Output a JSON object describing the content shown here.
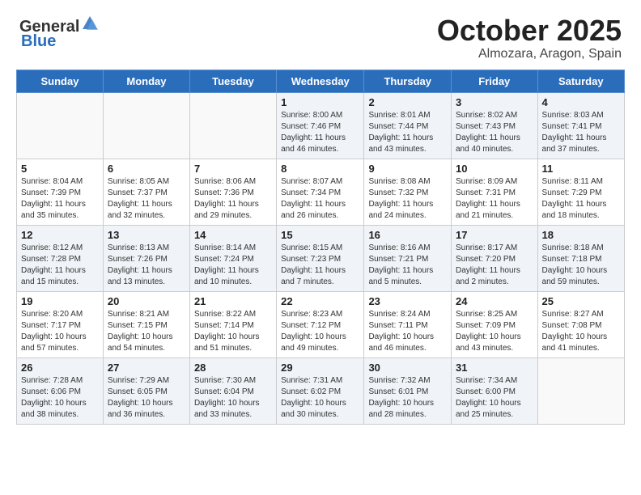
{
  "logo": {
    "general": "General",
    "blue": "Blue"
  },
  "header": {
    "month": "October 2025",
    "location": "Almozara, Aragon, Spain"
  },
  "weekdays": [
    "Sunday",
    "Monday",
    "Tuesday",
    "Wednesday",
    "Thursday",
    "Friday",
    "Saturday"
  ],
  "weeks": [
    [
      {
        "day": "",
        "info": ""
      },
      {
        "day": "",
        "info": ""
      },
      {
        "day": "",
        "info": ""
      },
      {
        "day": "1",
        "info": "Sunrise: 8:00 AM\nSunset: 7:46 PM\nDaylight: 11 hours and 46 minutes."
      },
      {
        "day": "2",
        "info": "Sunrise: 8:01 AM\nSunset: 7:44 PM\nDaylight: 11 hours and 43 minutes."
      },
      {
        "day": "3",
        "info": "Sunrise: 8:02 AM\nSunset: 7:43 PM\nDaylight: 11 hours and 40 minutes."
      },
      {
        "day": "4",
        "info": "Sunrise: 8:03 AM\nSunset: 7:41 PM\nDaylight: 11 hours and 37 minutes."
      }
    ],
    [
      {
        "day": "5",
        "info": "Sunrise: 8:04 AM\nSunset: 7:39 PM\nDaylight: 11 hours and 35 minutes."
      },
      {
        "day": "6",
        "info": "Sunrise: 8:05 AM\nSunset: 7:37 PM\nDaylight: 11 hours and 32 minutes."
      },
      {
        "day": "7",
        "info": "Sunrise: 8:06 AM\nSunset: 7:36 PM\nDaylight: 11 hours and 29 minutes."
      },
      {
        "day": "8",
        "info": "Sunrise: 8:07 AM\nSunset: 7:34 PM\nDaylight: 11 hours and 26 minutes."
      },
      {
        "day": "9",
        "info": "Sunrise: 8:08 AM\nSunset: 7:32 PM\nDaylight: 11 hours and 24 minutes."
      },
      {
        "day": "10",
        "info": "Sunrise: 8:09 AM\nSunset: 7:31 PM\nDaylight: 11 hours and 21 minutes."
      },
      {
        "day": "11",
        "info": "Sunrise: 8:11 AM\nSunset: 7:29 PM\nDaylight: 11 hours and 18 minutes."
      }
    ],
    [
      {
        "day": "12",
        "info": "Sunrise: 8:12 AM\nSunset: 7:28 PM\nDaylight: 11 hours and 15 minutes."
      },
      {
        "day": "13",
        "info": "Sunrise: 8:13 AM\nSunset: 7:26 PM\nDaylight: 11 hours and 13 minutes."
      },
      {
        "day": "14",
        "info": "Sunrise: 8:14 AM\nSunset: 7:24 PM\nDaylight: 11 hours and 10 minutes."
      },
      {
        "day": "15",
        "info": "Sunrise: 8:15 AM\nSunset: 7:23 PM\nDaylight: 11 hours and 7 minutes."
      },
      {
        "day": "16",
        "info": "Sunrise: 8:16 AM\nSunset: 7:21 PM\nDaylight: 11 hours and 5 minutes."
      },
      {
        "day": "17",
        "info": "Sunrise: 8:17 AM\nSunset: 7:20 PM\nDaylight: 11 hours and 2 minutes."
      },
      {
        "day": "18",
        "info": "Sunrise: 8:18 AM\nSunset: 7:18 PM\nDaylight: 10 hours and 59 minutes."
      }
    ],
    [
      {
        "day": "19",
        "info": "Sunrise: 8:20 AM\nSunset: 7:17 PM\nDaylight: 10 hours and 57 minutes."
      },
      {
        "day": "20",
        "info": "Sunrise: 8:21 AM\nSunset: 7:15 PM\nDaylight: 10 hours and 54 minutes."
      },
      {
        "day": "21",
        "info": "Sunrise: 8:22 AM\nSunset: 7:14 PM\nDaylight: 10 hours and 51 minutes."
      },
      {
        "day": "22",
        "info": "Sunrise: 8:23 AM\nSunset: 7:12 PM\nDaylight: 10 hours and 49 minutes."
      },
      {
        "day": "23",
        "info": "Sunrise: 8:24 AM\nSunset: 7:11 PM\nDaylight: 10 hours and 46 minutes."
      },
      {
        "day": "24",
        "info": "Sunrise: 8:25 AM\nSunset: 7:09 PM\nDaylight: 10 hours and 43 minutes."
      },
      {
        "day": "25",
        "info": "Sunrise: 8:27 AM\nSunset: 7:08 PM\nDaylight: 10 hours and 41 minutes."
      }
    ],
    [
      {
        "day": "26",
        "info": "Sunrise: 7:28 AM\nSunset: 6:06 PM\nDaylight: 10 hours and 38 minutes."
      },
      {
        "day": "27",
        "info": "Sunrise: 7:29 AM\nSunset: 6:05 PM\nDaylight: 10 hours and 36 minutes."
      },
      {
        "day": "28",
        "info": "Sunrise: 7:30 AM\nSunset: 6:04 PM\nDaylight: 10 hours and 33 minutes."
      },
      {
        "day": "29",
        "info": "Sunrise: 7:31 AM\nSunset: 6:02 PM\nDaylight: 10 hours and 30 minutes."
      },
      {
        "day": "30",
        "info": "Sunrise: 7:32 AM\nSunset: 6:01 PM\nDaylight: 10 hours and 28 minutes."
      },
      {
        "day": "31",
        "info": "Sunrise: 7:34 AM\nSunset: 6:00 PM\nDaylight: 10 hours and 25 minutes."
      },
      {
        "day": "",
        "info": ""
      }
    ]
  ]
}
